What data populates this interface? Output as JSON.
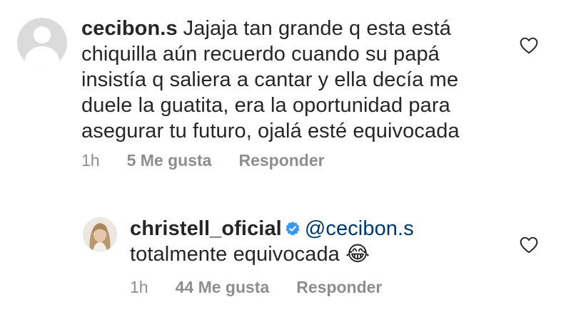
{
  "comments": [
    {
      "username": "cecibon.s",
      "text": "Jajaja tan grande q esta está chiquilla aún recuerdo cuando su papá insistía q saliera a cantar y ella decía me duele la guatita, era la oportunidad para asegurar tu futuro, ojalá esté equivocada",
      "time": "1h",
      "likes": "5 Me gusta",
      "reply": "Responder",
      "avatar": "default-avatar-icon"
    },
    {
      "username": "christell_oficial",
      "verified": true,
      "mention": "@cecibon.s",
      "text": "totalmente equivocada",
      "emoji": "😂",
      "time": "1h",
      "likes": "44 Me gusta",
      "reply": "Responder",
      "avatar": "profile-photo"
    }
  ],
  "colors": {
    "text": "#262626",
    "meta": "#8e8e8e",
    "mention": "#00376b",
    "verified": "#3897f0",
    "avatar_default_bg": "#dbdbdb"
  }
}
